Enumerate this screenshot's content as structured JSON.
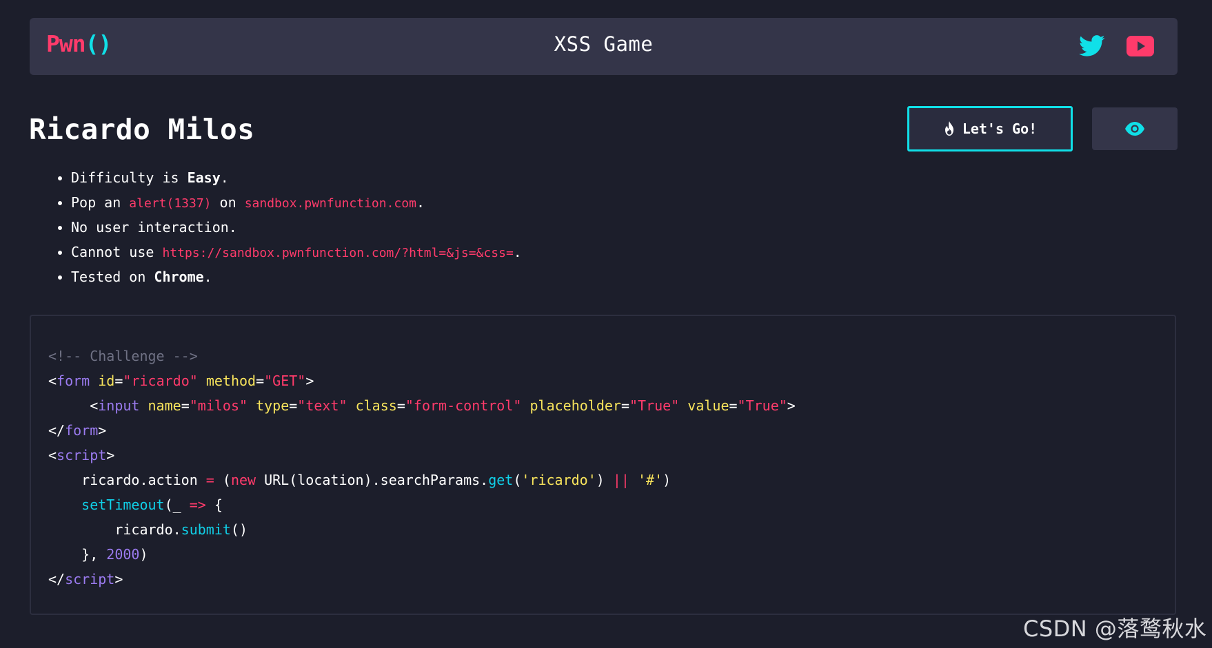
{
  "navbar": {
    "brand_pwn": "Pwn",
    "brand_paren": "()",
    "title": "XSS Game",
    "twitter_icon": "twitter-icon",
    "youtube_icon": "youtube-icon"
  },
  "challenge": {
    "title": "Ricardo Milos",
    "go_button_label": "Let's Go!",
    "go_button_icon": "fire-icon",
    "view_button_icon": "eye-icon"
  },
  "rules": [
    {
      "prefix": "Difficulty is ",
      "strong": "Easy",
      "suffix": "."
    },
    {
      "prefix": "Pop an ",
      "code1": "alert(1337)",
      "middle": " on ",
      "code2": "sandbox.pwnfunction.com",
      "suffix": "."
    },
    {
      "text": "No user interaction."
    },
    {
      "prefix": "Cannot use ",
      "code": "https://sandbox.pwnfunction.com/?html=&js=&css=",
      "suffix": "."
    },
    {
      "prefix": "Tested on ",
      "strong": "Chrome",
      "suffix": "."
    }
  ],
  "code": {
    "comment": "<!-- Challenge -->",
    "form_tag": "form",
    "form_id_attr": "id",
    "form_id_val": "\"ricardo\"",
    "form_method_attr": "method",
    "form_method_val": "\"GET\"",
    "input_tag": "input",
    "input_name_attr": "name",
    "input_name_val": "\"milos\"",
    "input_type_attr": "type",
    "input_type_val": "\"text\"",
    "input_class_attr": "class",
    "input_class_val": "\"form-control\"",
    "input_placeholder_attr": "placeholder",
    "input_placeholder_val": "\"True\"",
    "input_value_attr": "value",
    "input_value_val": "\"True\"",
    "script_tag": "script",
    "action_lhs": "ricardo.action ",
    "eq": "=",
    "paren_open": " (",
    "new_kw": "new",
    "url_call": " URL(location).searchParams.",
    "get_fn": "get",
    "get_arg_open": "(",
    "get_arg": "'ricardo'",
    "get_arg_close": ") ",
    "or_op": "||",
    "hash_space": " ",
    "hash_str": "'#'",
    "close_paren": ")",
    "settimeout_fn": "setTimeout",
    "settimeout_open": "(_ ",
    "arrow": "=>",
    "brace_open": " {",
    "submit_obj": "ricardo.",
    "submit_fn": "submit",
    "submit_call": "()",
    "timeout_close": "}, ",
    "timeout_ms": "2000",
    "timeout_end": ")"
  },
  "watermark": "CSDN @落鹜秋水",
  "colors": {
    "background": "#1c1e2b",
    "navbar": "#343549",
    "accent_pink": "#ff3b6b",
    "accent_cyan": "#10e0e8"
  }
}
